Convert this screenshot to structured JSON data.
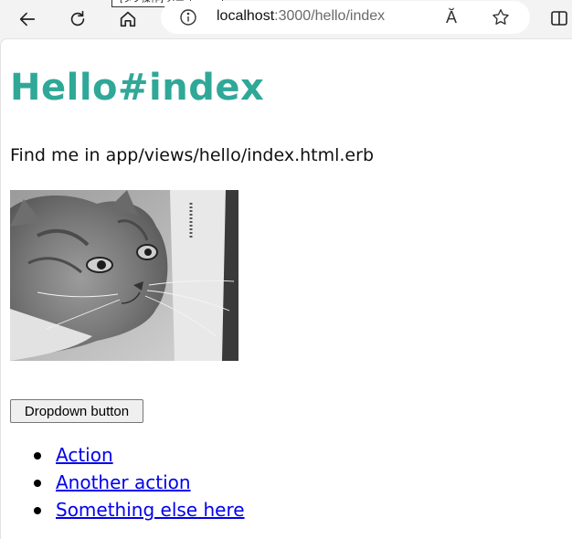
{
  "browser": {
    "tooltip": "[タブ操作] メニュー",
    "url_host": "localhost",
    "url_path": ":3000/hello/index",
    "read_aloud": "Ă"
  },
  "page": {
    "title": "Hello#index",
    "text": "Find me in app/views/hello/index.html.erb",
    "image": "cat-photo",
    "dropdown_label": "Dropdown button",
    "menu_items": [
      "Action",
      "Another action",
      "Something else here"
    ]
  },
  "colors": {
    "title": "#2fa898",
    "link": "#0000ee"
  }
}
